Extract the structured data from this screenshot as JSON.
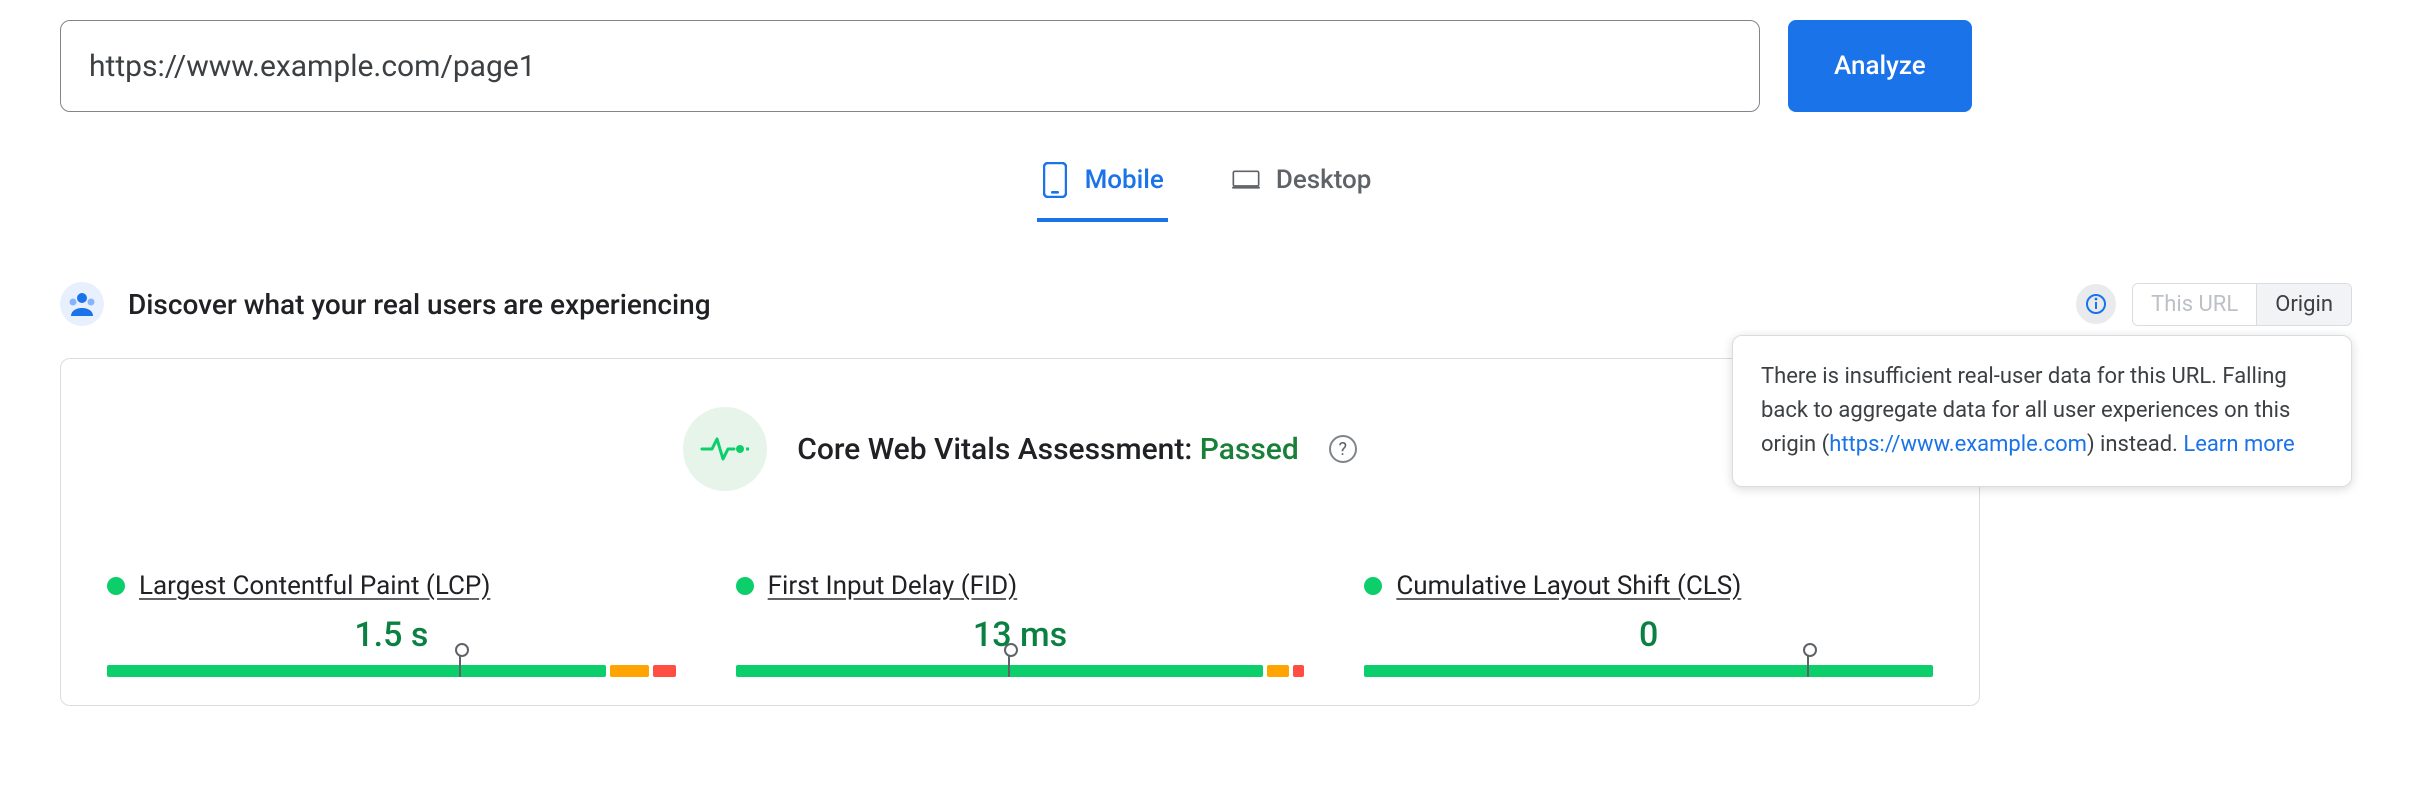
{
  "url_input": {
    "value": "https://www.example.com/page1"
  },
  "analyze_label": "Analyze",
  "tabs": {
    "mobile": "Mobile",
    "desktop": "Desktop"
  },
  "discover_title": "Discover what your real users are experiencing",
  "scope": {
    "this_url": "This URL",
    "origin": "Origin"
  },
  "tooltip": {
    "prefix": "There is insufficient real-user data for this URL. Falling back to aggregate data for all user experiences on this origin (",
    "link": "https://www.example.com",
    "after_link": ") instead. ",
    "learn_more": "Learn more"
  },
  "cwv": {
    "label": "Core Web Vitals Assessment: ",
    "status": "Passed"
  },
  "metrics": {
    "lcp": {
      "name": "Largest Contentful Paint (LCP)",
      "value": "1.5 s"
    },
    "fid": {
      "name": "First Input Delay (FID)",
      "value": "13 ms"
    },
    "cls": {
      "name": "Cumulative Layout Shift (CLS)",
      "value": "0"
    }
  }
}
